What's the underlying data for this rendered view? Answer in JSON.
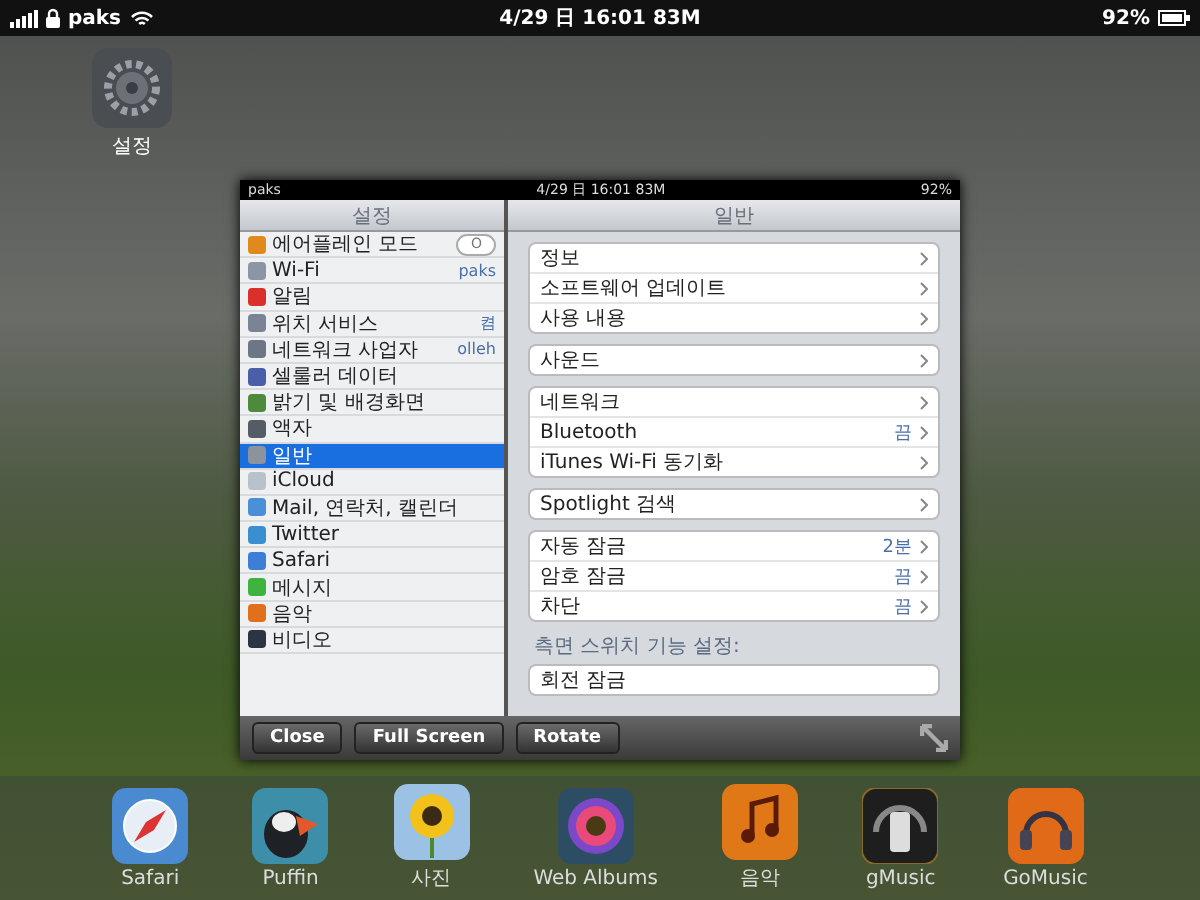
{
  "status_bar": {
    "carrier": "paks",
    "datetime": "4/29 日 16:01 83M",
    "battery": "92%"
  },
  "home_icon": {
    "label": "설정"
  },
  "panel": {
    "status_bar": {
      "carrier": "paks",
      "datetime": "4/29 日 16:01 83M",
      "battery": "92%"
    },
    "sidebar": {
      "title": "설정",
      "items": [
        {
          "label": "에어플레인 모드",
          "color": "#e08a1e",
          "toggle": {
            "on": false,
            "label": "O"
          },
          "selected": false
        },
        {
          "label": "Wi-Fi",
          "value": "paks",
          "color": "#8a95a5",
          "selected": false
        },
        {
          "label": "알림",
          "color": "#d9302c",
          "selected": false
        },
        {
          "label": "위치 서비스",
          "value": "켬",
          "color": "#7a8494",
          "selected": false
        },
        {
          "label": "네트워크 사업자",
          "value": "olleh",
          "color": "#6d7684",
          "selected": false
        },
        {
          "label": "셀룰러 데이터",
          "color": "#4a5fa8",
          "selected": false
        },
        {
          "label": "밝기 및 배경화면",
          "color": "#4d8a3c",
          "selected": false
        },
        {
          "label": "액자",
          "color": "#555c66",
          "selected": false
        },
        {
          "label": "일반",
          "color": "#8c939c",
          "selected": true
        },
        {
          "label": "iCloud",
          "color": "#b9c2cc",
          "selected": false
        },
        {
          "label": "Mail, 연락처, 캘린더",
          "color": "#4a8fd8",
          "selected": false
        },
        {
          "label": "Twitter",
          "color": "#3a8fd0",
          "selected": false
        },
        {
          "label": "Safari",
          "color": "#3d7fd6",
          "selected": false
        },
        {
          "label": "메시지",
          "color": "#3fb33f",
          "selected": false
        },
        {
          "label": "음악",
          "color": "#e0701c",
          "selected": false
        },
        {
          "label": "비디오",
          "color": "#2b3440",
          "selected": false
        }
      ]
    },
    "detail": {
      "title": "일반",
      "groups": [
        {
          "rows": [
            {
              "label": "정보"
            },
            {
              "label": "소프트웨어 업데이트"
            },
            {
              "label": "사용 내용"
            }
          ]
        },
        {
          "rows": [
            {
              "label": "사운드"
            }
          ]
        },
        {
          "rows": [
            {
              "label": "네트워크"
            },
            {
              "label": "Bluetooth",
              "value": "끔"
            },
            {
              "label": "iTunes Wi-Fi 동기화"
            }
          ]
        },
        {
          "rows": [
            {
              "label": "Spotlight 검색"
            }
          ]
        },
        {
          "rows": [
            {
              "label": "자동 잠금",
              "value": "2분"
            },
            {
              "label": "암호 잠금",
              "value": "끔"
            },
            {
              "label": "차단",
              "value": "끔"
            }
          ]
        },
        {
          "header": "측면 스위치 기능 설정:",
          "rows": [
            {
              "label": "회전 잠금",
              "chevron": false
            }
          ]
        }
      ]
    },
    "buttons": [
      "Close",
      "Full Screen",
      "Rotate"
    ]
  },
  "dock": [
    {
      "label": "Safari",
      "kind": "compass"
    },
    {
      "label": "Puffin",
      "kind": "bird"
    },
    {
      "label": "사진",
      "kind": "sunflower"
    },
    {
      "label": "Web Albums",
      "kind": "flower"
    },
    {
      "label": "음악",
      "kind": "note"
    },
    {
      "label": "gMusic",
      "kind": "phone"
    },
    {
      "label": "GoMusic",
      "kind": "headphones"
    }
  ]
}
